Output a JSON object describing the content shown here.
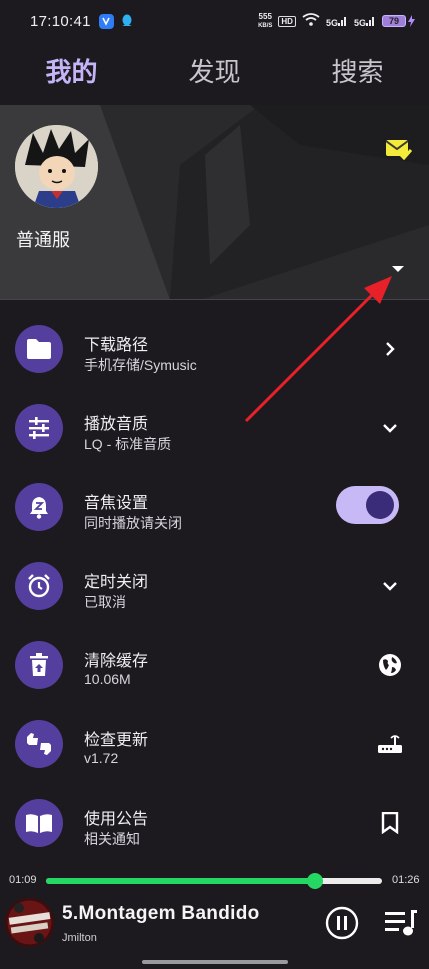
{
  "status_bar": {
    "time": "17:10:41",
    "net_speed_value": "555",
    "net_speed_unit": "KB/S",
    "hd_label": "HD",
    "signal_1": "5G",
    "signal_2": "5G",
    "battery_level": "79"
  },
  "tabs": [
    {
      "label": "我的",
      "active": true
    },
    {
      "label": "发现",
      "active": false
    },
    {
      "label": "搜索",
      "active": false
    }
  ],
  "header": {
    "username": "普通服",
    "accent_color": "#f4ea3a"
  },
  "settings": [
    {
      "title": "下载路径",
      "subtitle": "手机存储/Symusic",
      "icon": "folder-icon",
      "action": "chevron-right-icon"
    },
    {
      "title": "播放音质",
      "subtitle": "LQ - 标准音质",
      "icon": "tune-icon",
      "action": "chevron-down-icon"
    },
    {
      "title": "音焦设置",
      "subtitle": "同时播放请关闭",
      "icon": "bell-z-icon",
      "action": "toggle",
      "toggle_on": true
    },
    {
      "title": "定时关闭",
      "subtitle": "已取消",
      "icon": "alarm-icon",
      "action": "chevron-down-icon"
    },
    {
      "title": "清除缓存",
      "subtitle": "10.06M",
      "icon": "trash-icon",
      "action": "globe-icon"
    },
    {
      "title": "检查更新",
      "subtitle": "v1.72",
      "icon": "thumbs-icon",
      "action": "router-icon"
    },
    {
      "title": "使用公告",
      "subtitle": "相关通知",
      "icon": "book-icon",
      "action": "bookmark-icon"
    }
  ],
  "player": {
    "elapsed": "01:09",
    "duration": "01:26",
    "progress_fraction": 0.8,
    "song_title": "5.Montagem Bandido",
    "artist": "Jmilton",
    "progress_color": "#24d863"
  },
  "colors": {
    "background": "#1c1a1f",
    "icon_circle": "#553f9e",
    "active_tab": "#c4b5f8",
    "annotation_arrow": "#e8202a"
  }
}
